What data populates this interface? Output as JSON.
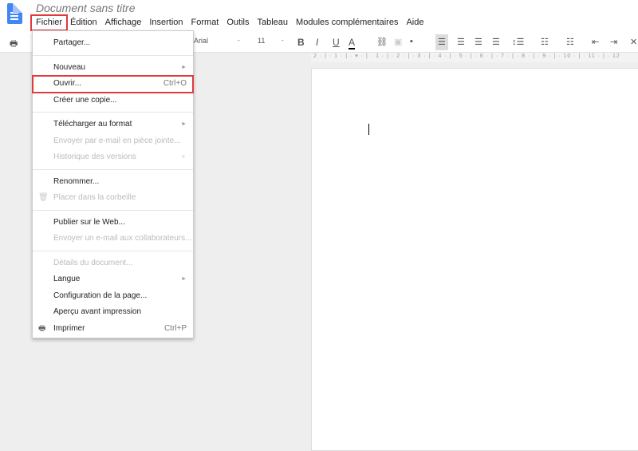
{
  "header": {
    "title": "Document sans titre"
  },
  "menubar": [
    "Fichier",
    "Édition",
    "Affichage",
    "Insertion",
    "Format",
    "Outils",
    "Tableau",
    "Modules complémentaires",
    "Aide"
  ],
  "toolbar": {
    "font": "Arial",
    "size": "11",
    "bold": "B",
    "italic": "I",
    "underline": "U",
    "text_color": "A"
  },
  "ruler": "2 · | · 1 · | · ▾ · | · 1 · | · 2 · | · 3 · | · 4 · | · 5 · | · 6 · | · 7 · | · 8 · | · 9 · | · 10 · | · 11 · | · 12",
  "menu": {
    "items": [
      {
        "label": "Partager..."
      },
      {
        "label": "Nouveau",
        "submenu": "►"
      },
      {
        "label": "Ouvrir...",
        "shortcut": "Ctrl+O"
      },
      {
        "label": "Créer une copie..."
      },
      {
        "label": "Télécharger au format",
        "submenu": "►"
      },
      {
        "label": "Envoyer par e-mail en pièce jointe..."
      },
      {
        "label": "Historique des versions",
        "submenu": "►"
      },
      {
        "label": "Renommer..."
      },
      {
        "label": "Placer dans la corbeille"
      },
      {
        "label": "Publier sur le Web..."
      },
      {
        "label": "Envoyer un e-mail aux collaborateurs..."
      },
      {
        "label": "Détails du document..."
      },
      {
        "label": "Langue",
        "submenu": "►"
      },
      {
        "label": "Configuration de la page..."
      },
      {
        "label": "Aperçu avant impression"
      },
      {
        "label": "Imprimer",
        "shortcut": "Ctrl+P"
      }
    ]
  },
  "colors": {
    "highlight": "#e0393e",
    "brand": "#4285f4"
  }
}
